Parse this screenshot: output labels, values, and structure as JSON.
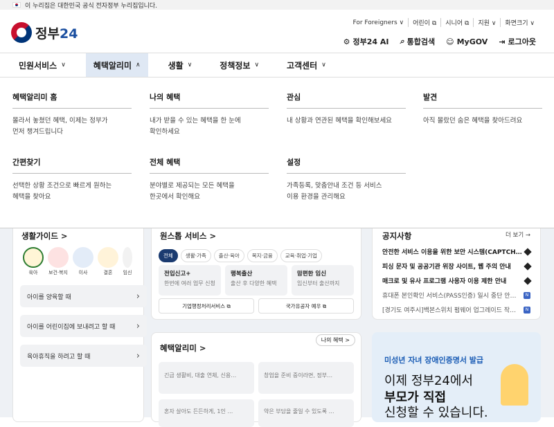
{
  "topbar": {
    "text": "이 누리집은 대한민국 공식 전자정부 누리집입니다."
  },
  "logo": {
    "text": "정부",
    "num": "24"
  },
  "util": [
    "For Foreigners ∨",
    "어린이 ⧉",
    "시니어 ⧉",
    "지원 ∨",
    "화면크기 ∨"
  ],
  "actions": [
    {
      "icon": "ai-icon",
      "label": "정부24 AI",
      "glyph": "⚙"
    },
    {
      "icon": "search-icon",
      "label": "통합검색",
      "glyph": "⌕"
    },
    {
      "icon": "user-icon",
      "label": "MyGOV",
      "glyph": "☺"
    },
    {
      "icon": "login-icon",
      "label": "로그아웃",
      "glyph": "⇥"
    }
  ],
  "gnb": [
    {
      "label": "민원서비스",
      "chev": "∨"
    },
    {
      "label": "혜택알리미",
      "chev": "∧"
    },
    {
      "label": "생활",
      "chev": "∨"
    },
    {
      "label": "정책정보",
      "chev": "∨"
    },
    {
      "label": "고객센터",
      "chev": "∨"
    }
  ],
  "mega": [
    {
      "title": "혜택알리미 홈",
      "desc": [
        "몰라서 놓쳤던 혜택, 이제는 정부가",
        "먼저 챙겨드립니다"
      ]
    },
    {
      "title": "나의 혜택",
      "desc": [
        "내가 받을 수 있는 혜택을 한 눈에",
        "확인하세요"
      ]
    },
    {
      "title": "관심",
      "desc": [
        "내 상황과 연관된 혜택을 확인해보세요"
      ]
    },
    {
      "title": "발견",
      "desc": [
        "아직 몰랐던 숨은 혜택을 찾아드려요"
      ]
    },
    {
      "title": "간편찾기",
      "desc": [
        "선택한 상황 조건으로 빠르게 원하는",
        "혜택을 찾아요"
      ]
    },
    {
      "title": "전체 혜택",
      "desc": [
        "분야별로 제공되는 모든 혜택을",
        "한곳에서 확인해요"
      ]
    },
    {
      "title": "설정",
      "desc": [
        "가족등록, 맞춤안내 조건 등 서비스",
        "이용 환경을 관리해요"
      ]
    }
  ],
  "life": {
    "title": "생활가이드 >",
    "icons": [
      "육아",
      "보건·복지",
      "이사",
      "결혼",
      "임신"
    ],
    "rows": [
      "아이를 양육할 때",
      "아이를 어린이집에 보내려고 할 때",
      "육아휴직을 하려고 할 때"
    ]
  },
  "onestop": {
    "title": "원스톱 서비스 >",
    "chips": [
      "전체",
      "생활·가족",
      "출산·육아",
      "복지·금융",
      "교육·취업·기업"
    ],
    "items": [
      {
        "t": "전입신고+",
        "d": "한번에 여러 업무 신청"
      },
      {
        "t": "행복출산",
        "d": "출산 후 다양한 혜택"
      },
      {
        "t": "맘편한 임신",
        "d": "임신부터 출산까지"
      }
    ],
    "links": [
      "기업행정처리서비스 ⧉",
      "국가유공자 예우 ⧉"
    ]
  },
  "benefit": {
    "title": "혜택알리미 >",
    "my": "나의 혜택 >",
    "items": [
      "긴급 생활비, 대출 연체, 신용…",
      "창업을 준비 중이라면, 정부…",
      "혼자 살아도 든든하게, 1인 …",
      "약은 부담을 줄일 수 있도록 …"
    ]
  },
  "notice": {
    "title": "공지사항",
    "more": "더 보기 →",
    "items": [
      {
        "t": "안전한 서비스 이용을 위한 보안 시스템(CAPTCH…",
        "k": "pin"
      },
      {
        "t": "피싱 문자 및 공공기관 위장 사이트, 웹 주의 안내",
        "k": "pin"
      },
      {
        "t": "매크로 및 유사 프로그램 사용자 이용 제한 안내",
        "k": "pin"
      },
      {
        "t": "휴대폰 본인확인 서비스(PASS인증) 일시 중단 안…",
        "k": "N"
      },
      {
        "t": "[경기도 여주시]백본스위치 펌웨어 업그레이드 작…",
        "k": "N"
      }
    ]
  },
  "banner": {
    "l1": "미성년 자녀 장애인증명서 발급",
    "l2": "이제 정부24에서",
    "l3": "부모가 직접",
    "l4": "신청할 수 있습니다."
  }
}
